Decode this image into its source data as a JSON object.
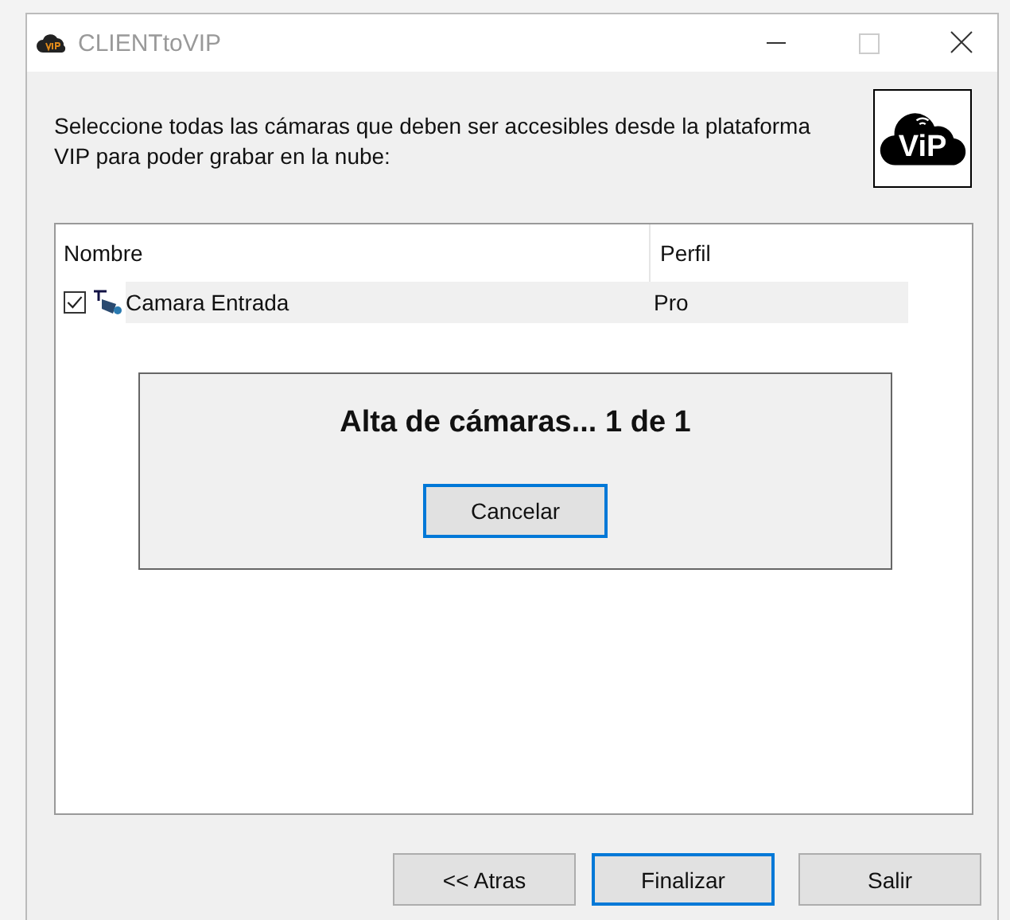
{
  "window": {
    "title": "CLIENTtoVIP"
  },
  "instructions": "Seleccione todas las cámaras que deben ser accesibles desde la plataforma VIP para poder grabar en la nube:",
  "logo": {
    "text": "ViP"
  },
  "table": {
    "columns": [
      "Nombre",
      "Perfil"
    ],
    "rows": [
      {
        "name": "Camara Entrada",
        "profile": "Pro",
        "checked": true,
        "selected": true
      }
    ]
  },
  "progress": {
    "message": "Alta de cámaras... 1 de 1",
    "button": {
      "label": "Cancelar",
      "focused": true
    }
  },
  "buttons": [
    {
      "label": "<< Atras",
      "focused": false
    },
    {
      "label": "Finalizar",
      "focused": true
    },
    {
      "label": "Salir",
      "focused": false
    }
  ]
}
